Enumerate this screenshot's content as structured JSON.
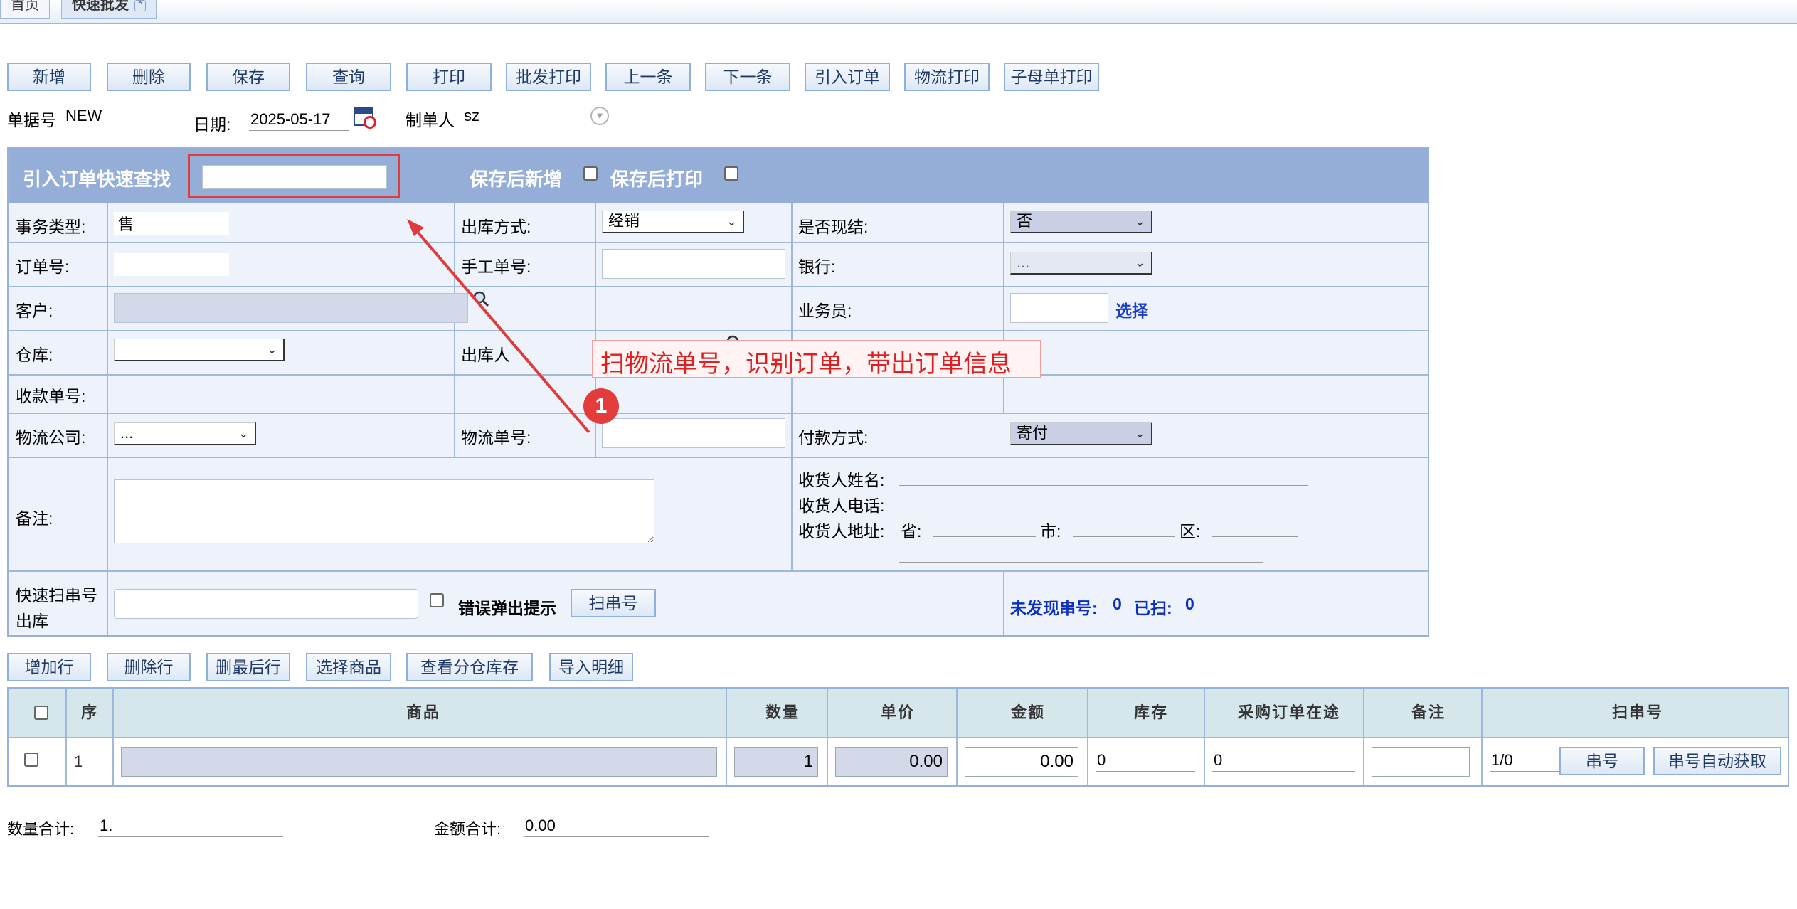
{
  "tabs": [
    {
      "label": "首页"
    },
    {
      "label": "快速批发"
    }
  ],
  "toolbar": [
    "新增",
    "删除",
    "保存",
    "查询",
    "打印",
    "批发打印",
    "上一条",
    "下一条",
    "引入订单",
    "物流打印",
    "子母单打印"
  ],
  "meta": {
    "doc_no_label": "单据号",
    "doc_no_value": "NEW",
    "date_label": "日期:",
    "date_value": "2025-05-17",
    "maker_label": "制单人",
    "maker_value": "sz"
  },
  "header": {
    "quick_find_label": "引入订单快速查找",
    "save_new_label": "保存后新增",
    "save_print_label": "保存后打印"
  },
  "form": {
    "biz_type_label": "事务类型:",
    "biz_type_value": "售",
    "out_method_label": "出库方式:",
    "out_method_value": "经销",
    "cash_settle_label": "是否现结:",
    "cash_settle_value": "否",
    "order_no_label": "订单号:",
    "manual_no_label": "手工单号:",
    "bank_label": "银行:",
    "bank_value": "...",
    "customer_label": "客户:",
    "salesman_label": "业务员:",
    "select_link": "选择",
    "warehouse_label": "仓库:",
    "out_person_label": "出库人",
    "receipt_no_label": "收款单号:",
    "logistics_co_label": "物流公司:",
    "logistics_co_value": "...",
    "tracking_no_label": "物流单号:",
    "payment_label": "付款方式:",
    "payment_value": "寄付",
    "remark_label": "备注:",
    "consignee_name_label": "收货人姓名:",
    "consignee_phone_label": "收货人电话:",
    "consignee_addr_label": "收货人地址:",
    "province_label": "省:",
    "city_label": "市:",
    "district_label": "区:",
    "scan_label_1": "快速扫串号",
    "scan_label_2": "出库",
    "error_popup_label": "错误弹出提示",
    "scan_btn": "扫串号",
    "not_found_label": "未发现串号:",
    "not_found_value": "0",
    "scanned_label": "已扫:",
    "scanned_value": "0"
  },
  "annotation": {
    "callout": "扫物流单号，识别订单，带出订单信息",
    "badge": "1",
    "color": "#e03a3a"
  },
  "row_actions": [
    "增加行",
    "删除行",
    "删最后行",
    "选择商品",
    "查看分仓库存",
    "导入明细"
  ],
  "grid": {
    "columns": [
      "序",
      "商品",
      "数量",
      "单价",
      "金额",
      "库存",
      "采购订单在途",
      "备注",
      "扫串号"
    ],
    "rows": [
      {
        "seq": "1",
        "product": "",
        "qty": "1",
        "price": "0.00",
        "amount": "0.00",
        "stock": "0",
        "transit": "0",
        "remark": "",
        "serial": "1/0",
        "serial_btn": "串号",
        "serial_auto_btn": "串号自动获取"
      }
    ]
  },
  "totals": {
    "qty_label": "数量合计:",
    "qty_value": "1.",
    "amount_label": "金额合计:",
    "amount_value": "0.00"
  }
}
